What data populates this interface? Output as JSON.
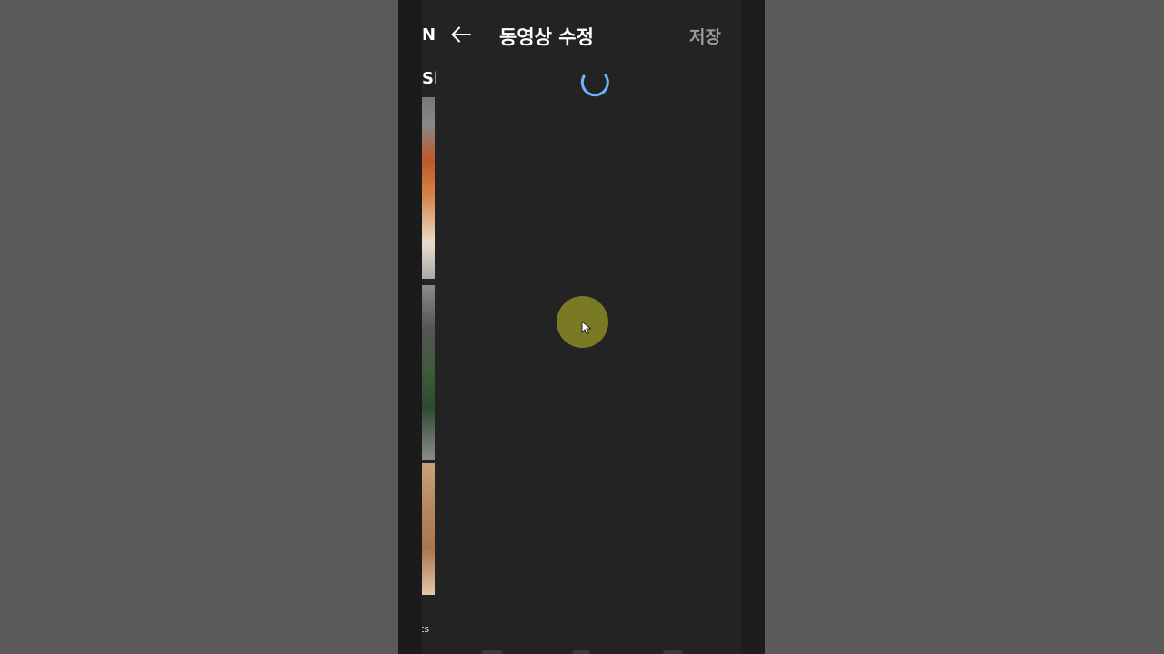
{
  "header": {
    "title": "동영상 수정",
    "save_label": "저장"
  },
  "background_page": {
    "text_top": "NS",
    "text_second": "Sh",
    "text_bottom": "ts"
  },
  "icons": {
    "back": "arrow-left-icon",
    "loading": "loading-spinner-icon",
    "cursor": "mouse-cursor-icon"
  },
  "colors": {
    "spinner": "#6cb4ff",
    "tap_indicator": "#7a7a25",
    "save_disabled": "#9a9a9a"
  }
}
